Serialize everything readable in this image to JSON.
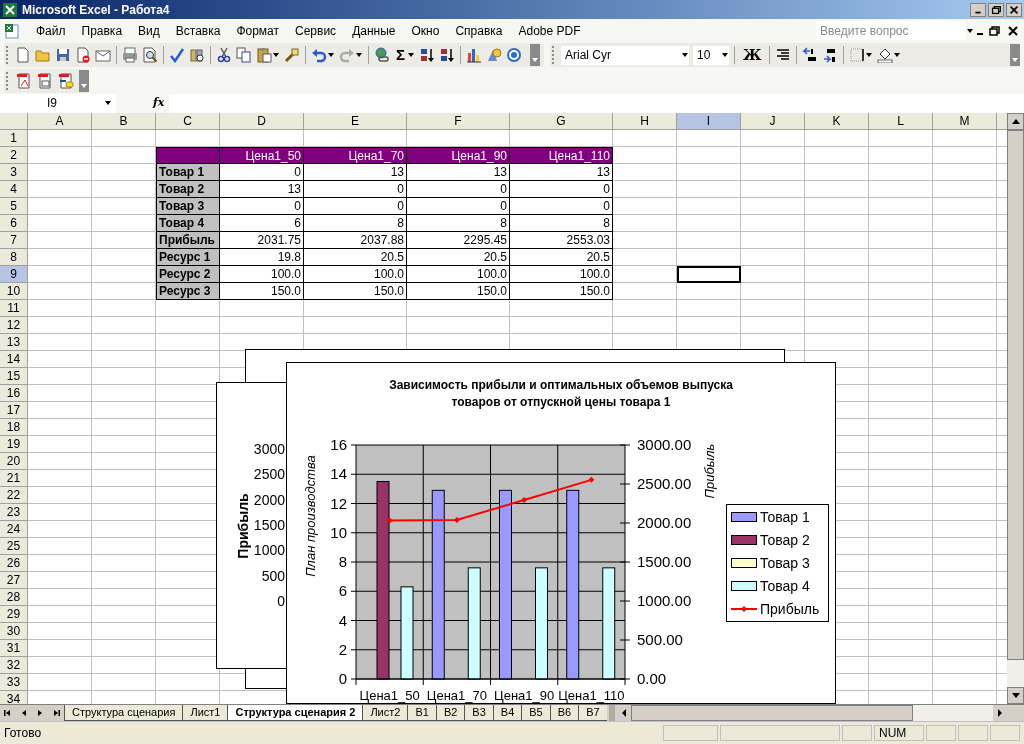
{
  "window": {
    "title": "Microsoft Excel - Работа4"
  },
  "menu": [
    "Файл",
    "Правка",
    "Вид",
    "Вставка",
    "Формат",
    "Сервис",
    "Данные",
    "Окно",
    "Справка",
    "Adobe PDF"
  ],
  "help_box": {
    "placeholder": "Введите вопрос"
  },
  "toolbar": {
    "autosum": "Σ",
    "font": "Arial Cyr",
    "font_size": "10",
    "bold": "Ж"
  },
  "name_box": "I9",
  "formula_label": "fx",
  "sheet": {
    "columns": [
      {
        "label": "A",
        "selected": false
      },
      {
        "label": "B",
        "selected": false
      },
      {
        "label": "C",
        "selected": false
      },
      {
        "label": "D",
        "selected": false
      },
      {
        "label": "E",
        "selected": false
      },
      {
        "label": "F",
        "selected": false
      },
      {
        "label": "G",
        "selected": false
      },
      {
        "label": "H",
        "selected": false
      },
      {
        "label": "I",
        "selected": true
      },
      {
        "label": "J",
        "selected": false
      },
      {
        "label": "K",
        "selected": false
      },
      {
        "label": "L",
        "selected": false
      },
      {
        "label": "M",
        "selected": false
      }
    ],
    "rows": [
      {
        "label": "1",
        "selected": false
      },
      {
        "label": "2",
        "selected": false
      },
      {
        "label": "3",
        "selected": false
      },
      {
        "label": "4",
        "selected": false
      },
      {
        "label": "5",
        "selected": false
      },
      {
        "label": "6",
        "selected": false
      },
      {
        "label": "7",
        "selected": false
      },
      {
        "label": "8",
        "selected": false
      },
      {
        "label": "9",
        "selected": true
      },
      {
        "label": "10",
        "selected": false
      },
      {
        "label": "11",
        "selected": false
      },
      {
        "label": "12",
        "selected": false
      },
      {
        "label": "13",
        "selected": false
      },
      {
        "label": "14",
        "selected": false
      },
      {
        "label": "15",
        "selected": false
      },
      {
        "label": "16",
        "selected": false
      },
      {
        "label": "17",
        "selected": false
      },
      {
        "label": "18",
        "selected": false
      },
      {
        "label": "19",
        "selected": false
      },
      {
        "label": "20",
        "selected": false
      },
      {
        "label": "21",
        "selected": false
      },
      {
        "label": "22",
        "selected": false
      },
      {
        "label": "23",
        "selected": false
      },
      {
        "label": "24",
        "selected": false
      },
      {
        "label": "25",
        "selected": false
      },
      {
        "label": "26",
        "selected": false
      },
      {
        "label": "27",
        "selected": false
      },
      {
        "label": "28",
        "selected": false
      },
      {
        "label": "29",
        "selected": false
      },
      {
        "label": "30",
        "selected": false
      },
      {
        "label": "31",
        "selected": false
      },
      {
        "label": "32",
        "selected": false
      },
      {
        "label": "33",
        "selected": false
      },
      {
        "label": "34",
        "selected": false
      }
    ],
    "table": {
      "header": [
        "Цена1_50",
        "Цена1_70",
        "Цена1_90",
        "Цена1_110"
      ],
      "rows": [
        {
          "label": "Товар 1",
          "values": [
            "0",
            "13",
            "13",
            "13"
          ]
        },
        {
          "label": "Товар 2",
          "values": [
            "13",
            "0",
            "0",
            "0"
          ]
        },
        {
          "label": "Товар 3",
          "values": [
            "0",
            "0",
            "0",
            "0"
          ]
        },
        {
          "label": "Товар 4",
          "values": [
            "6",
            "8",
            "8",
            "8"
          ]
        },
        {
          "label": "Прибыль",
          "values": [
            "2031.75",
            "2037.88",
            "2295.45",
            "2553.03"
          ]
        },
        {
          "label": "Ресурс 1",
          "values": [
            "19.8",
            "20.5",
            "20.5",
            "20.5"
          ]
        },
        {
          "label": "Ресурс 2",
          "values": [
            "100.0",
            "100.0",
            "100.0",
            "100.0"
          ]
        },
        {
          "label": "Ресурс 3",
          "values": [
            "150.0",
            "150.0",
            "150.0",
            "150.0"
          ]
        }
      ]
    }
  },
  "charts": [
    {
      "kind": "blank"
    },
    {
      "kind": "axis",
      "y_title": "Прибыль",
      "y_ticks": [
        "3000",
        "2500",
        "2000",
        "1500",
        "1000",
        "500",
        "0"
      ]
    },
    {
      "kind": "main",
      "chart_data": {
        "type": "bar",
        "title": "Зависимость прибыли и оптимальных объемов выпуска\nтоваров от отпускной цены товара 1",
        "ylabel": "План производства",
        "y2label": "Прибыль",
        "categories": [
          "Цена1_50",
          "Цена1_70",
          "Цена1_90",
          "Цена1_110"
        ],
        "series": [
          {
            "name": "Товар 1",
            "color": "#9999ff",
            "values": [
              0,
              12.9,
              12.9,
              12.9
            ]
          },
          {
            "name": "Товар 2",
            "color": "#993366",
            "values": [
              13.5,
              0,
              0,
              0
            ]
          },
          {
            "name": "Товар 3",
            "color": "#ffffcc",
            "values": [
              0,
              0,
              0,
              0
            ]
          },
          {
            "name": "Товар 4",
            "color": "#ccffff",
            "values": [
              6.3,
              7.6,
              7.6,
              7.6
            ]
          },
          {
            "name": "Прибыль",
            "color": "#ff0000",
            "type": "line",
            "axis": "y2",
            "marker": "diamond",
            "values": [
              2031.75,
              2037.88,
              2295.45,
              2553.03
            ]
          }
        ],
        "grid": true,
        "legend": "right",
        "ylim": [
          0,
          16
        ],
        "yticks": [
          0,
          2,
          4,
          6,
          8,
          10,
          12,
          14,
          16
        ],
        "y2lim": [
          0,
          3000
        ],
        "y2ticks": [
          {
            "value": 0,
            "label": "0.00"
          },
          {
            "value": 500,
            "label": "500.00"
          },
          {
            "value": 1000,
            "label": "1000.00"
          },
          {
            "value": 1500,
            "label": "1500.00"
          },
          {
            "value": 2000,
            "label": "2000.00"
          },
          {
            "value": 2500,
            "label": "2500.00"
          },
          {
            "value": 3000,
            "label": "3000.00"
          }
        ]
      }
    }
  ],
  "sheet_tabs": [
    {
      "label": "Структура сценария",
      "selected": false
    },
    {
      "label": "Лист1",
      "selected": false
    },
    {
      "label": "Структура сценария 2",
      "selected": true
    },
    {
      "label": "Лист2",
      "selected": false
    },
    {
      "label": "B1",
      "selected": false
    },
    {
      "label": "B2",
      "selected": false
    },
    {
      "label": "B3",
      "selected": false
    },
    {
      "label": "B4",
      "selected": false
    },
    {
      "label": "B5",
      "selected": false
    },
    {
      "label": "B6",
      "selected": false
    },
    {
      "label": "B7",
      "selected": false
    }
  ],
  "status": {
    "text": "Готово",
    "num": "NUM"
  }
}
